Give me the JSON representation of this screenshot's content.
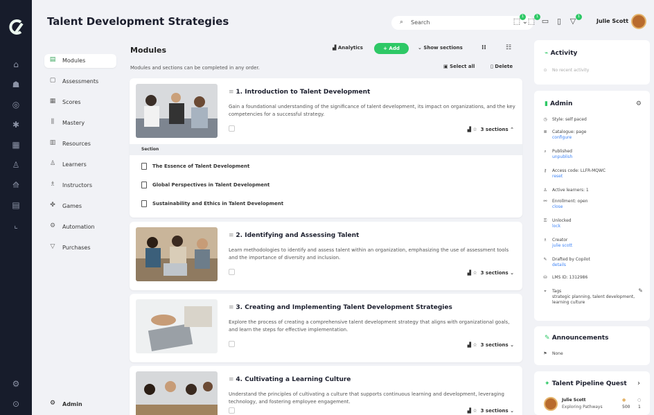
{
  "app": {
    "title": "Talent Development Strategies"
  },
  "search": {
    "placeholder": "Search"
  },
  "user": {
    "name": "Julie Scott"
  },
  "colors": {
    "accent": "#2ec866",
    "rail": "#171c2b",
    "link": "#3b82f6"
  },
  "rail": {
    "icons": [
      "logo-icon",
      "home-icon",
      "users-icon",
      "target-icon",
      "ai-icon",
      "grid-icon",
      "learner-icon",
      "chart-icon",
      "library-icon",
      "analytics-icon",
      "settings-icon",
      "help-icon"
    ]
  },
  "subnav": {
    "items": [
      {
        "label": "Modules",
        "icon": "module-icon"
      },
      {
        "label": "Assessments",
        "icon": "assessment-icon"
      },
      {
        "label": "Scores",
        "icon": "scores-icon"
      },
      {
        "label": "Mastery",
        "icon": "mastery-icon"
      },
      {
        "label": "Resources",
        "icon": "resources-icon"
      },
      {
        "label": "Learners",
        "icon": "learners-icon"
      },
      {
        "label": "Instructors",
        "icon": "instructors-icon"
      },
      {
        "label": "Games",
        "icon": "games-icon"
      },
      {
        "label": "Automation",
        "icon": "automation-icon"
      },
      {
        "label": "Purchases",
        "icon": "purchases-icon"
      }
    ],
    "admin": "Admin"
  },
  "main": {
    "heading": "Modules",
    "description": "Modules and sections can be completed in any order.",
    "toolbar": {
      "analytics": "Analytics",
      "add": "+ Add",
      "show_sections": "Show sections",
      "select_all": "Select all",
      "delete": "Delete"
    },
    "modules": [
      {
        "title": "1. Introduction to Talent Development",
        "desc": "Gain a foundational understanding of the significance of talent development, its impact on organizations, and the key competencies for a successful strategy.",
        "sections": "3 sections",
        "expanded": true
      },
      {
        "title": "2. Identifying and Assessing Talent",
        "desc": "Learn methodologies to identify and assess talent within an organization, emphasizing the use of assessment tools and the importance of diversity and inclusion.",
        "sections": "3 sections",
        "expanded": false
      },
      {
        "title": "3. Creating and Implementing Talent Development Strategies",
        "desc": "Explore the process of creating a comprehensive talent development strategy that aligns with organizational goals, and learn the steps for effective implementation.",
        "sections": "3 sections",
        "expanded": false
      },
      {
        "title": "4. Cultivating a Learning Culture",
        "desc": "Understand the principles of cultivating a culture that supports continuous learning and development, leveraging technology, and fostering employee engagement.",
        "sections": "3 sections",
        "expanded": false
      }
    ],
    "section_header": "Section",
    "sections": [
      "The Essence of Talent Development",
      "Global Perspectives in Talent Development",
      "Sustainability and Ethics in Talent Development"
    ]
  },
  "activity": {
    "title": "Activity",
    "empty": "No recent activity"
  },
  "admin": {
    "title": "Admin",
    "rows": [
      {
        "icon": "clock-icon",
        "text": "Style: self paced",
        "link": ""
      },
      {
        "icon": "catalogue-icon",
        "text": "Catalogue: page",
        "link": "configure"
      },
      {
        "icon": "search-icon",
        "text": "Published",
        "link": "unpublish"
      },
      {
        "icon": "key-icon",
        "text": "Access code: LLFR-MQWC",
        "link": "reset"
      },
      {
        "icon": "person-icon",
        "text": "Active learners: 1",
        "link": ""
      },
      {
        "icon": "enroll-icon",
        "text": "Enrollment: open",
        "link": "close"
      },
      {
        "icon": "lock-icon",
        "text": "Unlocked",
        "link": "lock"
      },
      {
        "icon": "creator-icon",
        "text": "Creator",
        "link": "julie scott"
      },
      {
        "icon": "copilot-icon",
        "text": "Drafted by Copilot",
        "link": "details"
      },
      {
        "icon": "db-icon",
        "text": "LMS ID: 1312986",
        "link": ""
      },
      {
        "icon": "tag-icon",
        "text": "Tags",
        "link": ""
      }
    ],
    "tags": "strategic planning, talent development, learning culture"
  },
  "announcements": {
    "title": "Announcements",
    "none": "None"
  },
  "quest": {
    "title": "Talent Pipeline Quest",
    "name": "Julie Scott",
    "sub": "Exploring Pathways",
    "score": "500",
    "rank": "1"
  }
}
